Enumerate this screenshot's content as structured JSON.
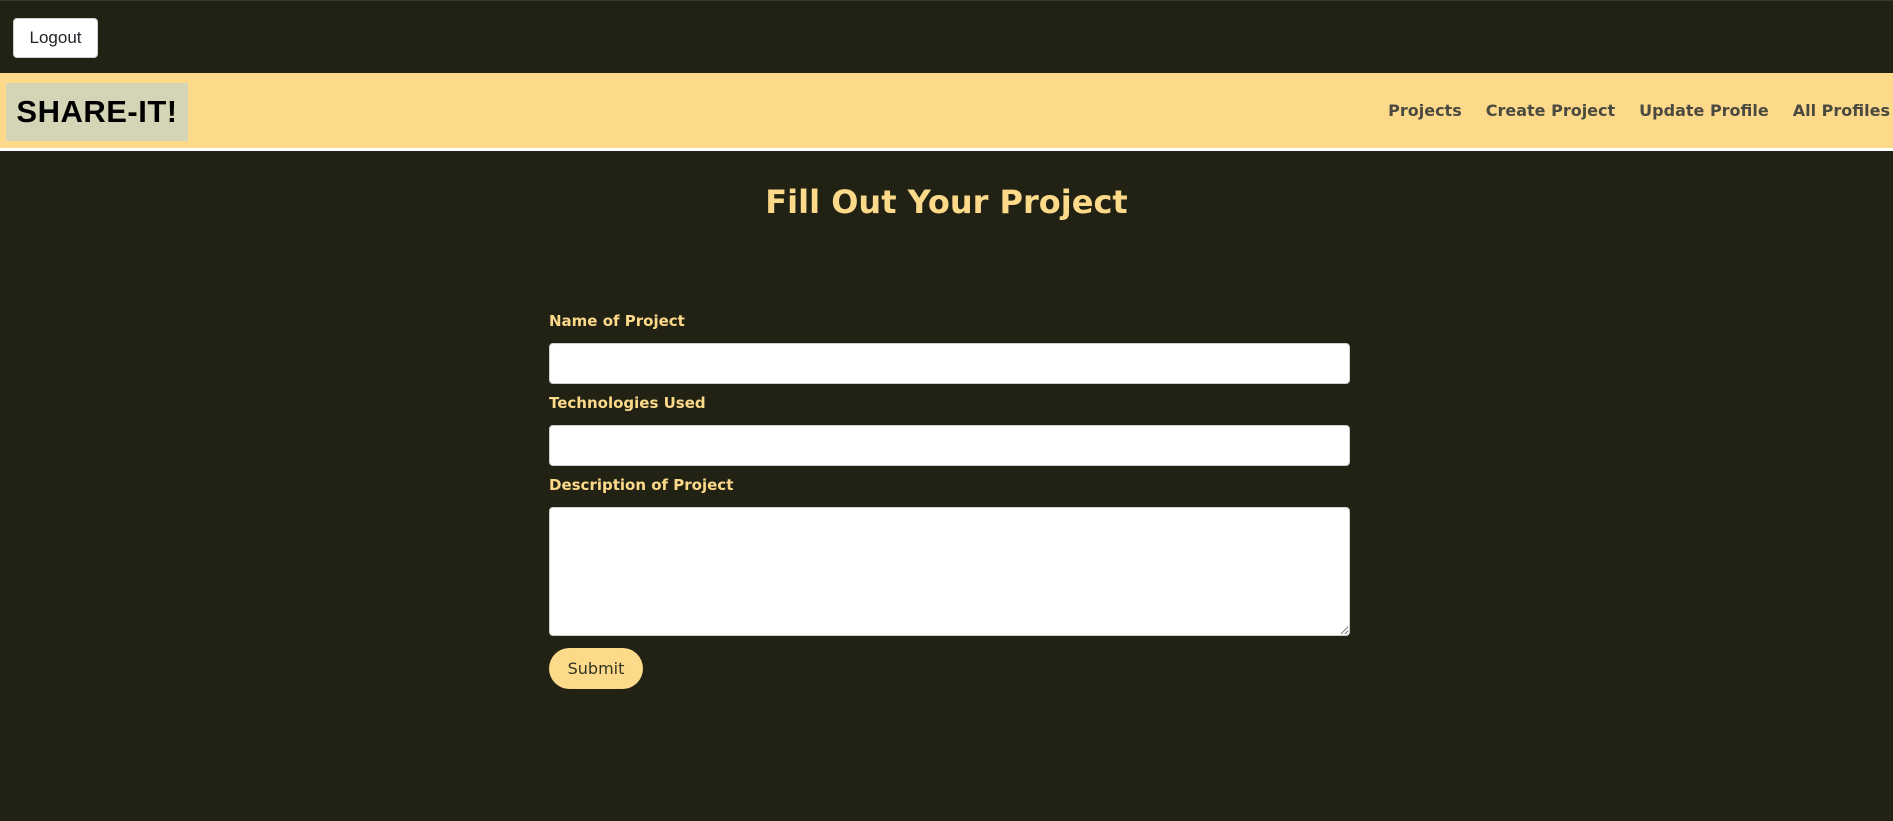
{
  "topbar": {
    "logout_label": "Logout"
  },
  "navbar": {
    "brand": "SHARE-IT!",
    "links": [
      {
        "label": "Projects"
      },
      {
        "label": "Create Project"
      },
      {
        "label": "Update Profile"
      },
      {
        "label": "All Profiles"
      }
    ]
  },
  "main": {
    "title": "Fill Out Your Project",
    "form": {
      "name_label": "Name of Project",
      "name_value": "",
      "tech_label": "Technologies Used",
      "tech_value": "",
      "description_label": "Description of Project",
      "description_value": "",
      "submit_label": "Submit"
    }
  },
  "colors": {
    "background": "#212114",
    "accent": "#fdd98a",
    "brand_box": "#d4d4b6"
  }
}
